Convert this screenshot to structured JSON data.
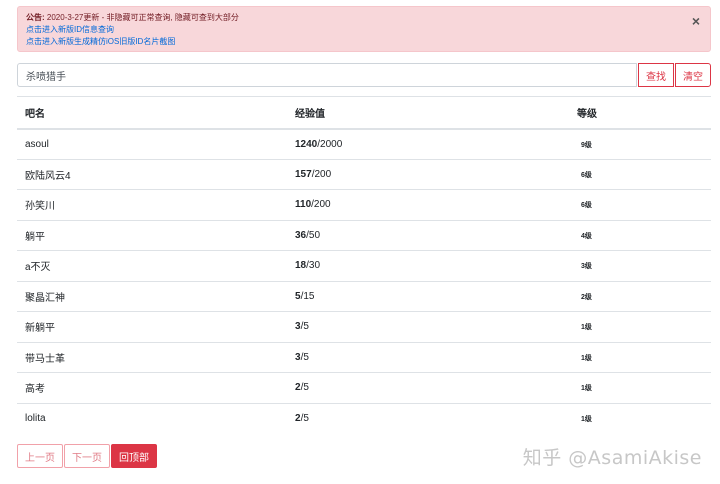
{
  "notice": {
    "label": "公告:",
    "text": "2020-3-27更新 - 非隐藏可正常查询, 隐藏可查到大部分",
    "link1": "点击进入新版ID信息查询",
    "link2": "点击进入新版生成精仿iOS旧版ID名片截图",
    "close": "×"
  },
  "search": {
    "value": "杀喷猎手",
    "search_label": "查找",
    "clear_label": "清空"
  },
  "table": {
    "headers": [
      "吧名",
      "经验值",
      "等级"
    ],
    "rows": [
      {
        "name": "asoul",
        "exp": "1240",
        "max": "/2000",
        "level": "9级"
      },
      {
        "name": "欧陆风云4",
        "exp": "157",
        "max": "/200",
        "level": "6级"
      },
      {
        "name": "孙笑川",
        "exp": "110",
        "max": "/200",
        "level": "6级"
      },
      {
        "name": "躺平",
        "exp": "36",
        "max": "/50",
        "level": "4级"
      },
      {
        "name": "a不灭",
        "exp": "18",
        "max": "/30",
        "level": "3级"
      },
      {
        "name": "聚晶汇神",
        "exp": "5",
        "max": "/15",
        "level": "2级"
      },
      {
        "name": "新躺平",
        "exp": "3",
        "max": "/5",
        "level": "1级"
      },
      {
        "name": "带马士革",
        "exp": "3",
        "max": "/5",
        "level": "1级"
      },
      {
        "name": "高考",
        "exp": "2",
        "max": "/5",
        "level": "1级"
      },
      {
        "name": "lolita",
        "exp": "2",
        "max": "/5",
        "level": "1级"
      }
    ]
  },
  "pager": {
    "prev": "上一页",
    "next": "下一页",
    "top": "回顶部"
  },
  "watermark": "知乎 @AsamiAkise",
  "colors": {
    "accent": "#dc3545",
    "alert_bg": "#f8d7da",
    "link": "#0069d9"
  }
}
